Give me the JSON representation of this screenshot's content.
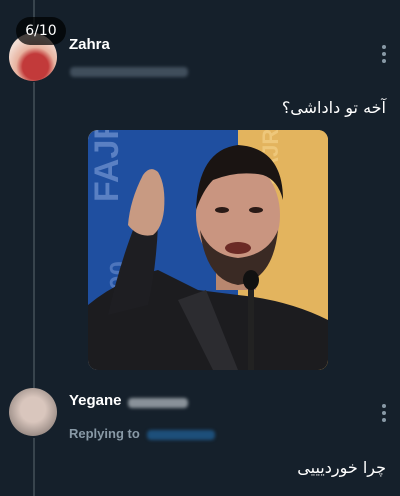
{
  "thread": {
    "counter": "6/10"
  },
  "tweets": [
    {
      "author": "Zahra",
      "text": "آخه تو داداشی؟",
      "more_icon": "more-vertical-icon"
    },
    {
      "author": "Yegane",
      "replying_label": "Replying to",
      "text": "چرا خوردیییی",
      "more_icon": "more-vertical-icon"
    }
  ],
  "colors": {
    "background": "#15202b",
    "thread_line": "#38444d",
    "secondary_text": "#8899a6",
    "poster_blue": "#1f4fa0",
    "poster_gold": "#e7b45a"
  }
}
